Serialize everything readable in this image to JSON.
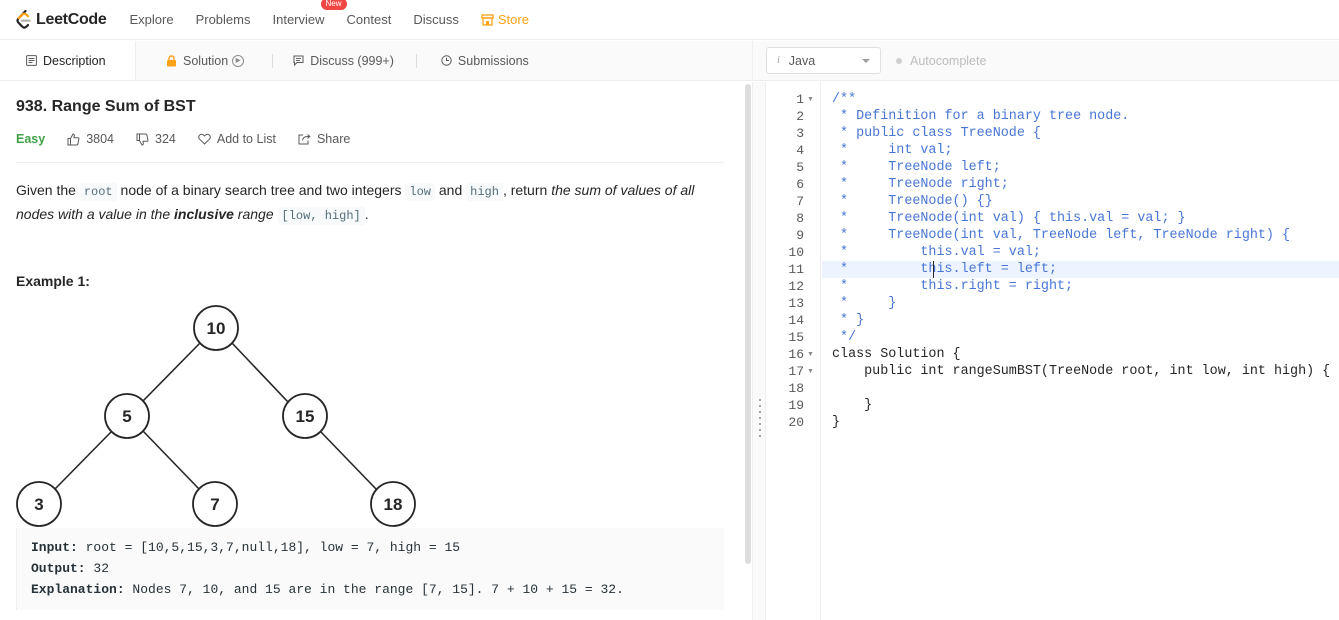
{
  "nav": {
    "logo_text": "LeetCode",
    "items": [
      {
        "label": "Explore"
      },
      {
        "label": "Problems"
      },
      {
        "label": "Interview",
        "badge": "New"
      },
      {
        "label": "Contest"
      },
      {
        "label": "Discuss"
      }
    ],
    "store_label": "Store",
    "store_color": "#ffa116",
    "badge_color": "#ef4743"
  },
  "tabs": {
    "description": "Description",
    "solution": "Solution",
    "discuss": "Discuss (999+)",
    "submissions": "Submissions"
  },
  "problem": {
    "title": "938. Range Sum of BST",
    "difficulty": "Easy",
    "difficulty_color": "#43a047",
    "likes": "3804",
    "dislikes": "324",
    "add_to_list": "Add to List",
    "share": "Share",
    "desc": {
      "p1": "Given the ",
      "c1": "root",
      "p2": " node of a binary search tree and two integers ",
      "c2": "low",
      "p3": " and ",
      "c3": "high",
      "p4": ", return ",
      "e1": "the sum of values of all nodes with a value in the ",
      "b1": "inclusive",
      "e2": " range ",
      "c4": "[low, high]",
      "p5": "."
    },
    "example_title": "Example 1:",
    "tree_nodes": [
      "10",
      "5",
      "15",
      "3",
      "7",
      "18"
    ],
    "example": {
      "input_label": "Input:",
      "input_value": " root = [10,5,15,3,7,null,18], low = 7, high = 15",
      "output_label": "Output:",
      "output_value": " 32",
      "explanation_label": "Explanation:",
      "explanation_value": " Nodes 7, 10, and 15 are in the range [7, 15]. 7 + 10 + 15 = 32."
    }
  },
  "editor": {
    "language": "Java",
    "language_icon": "i",
    "autocomplete": "Autocomplete",
    "line_numbers": [
      "1",
      "2",
      "3",
      "4",
      "5",
      "6",
      "7",
      "8",
      "9",
      "10",
      "11",
      "12",
      "13",
      "14",
      "15",
      "16",
      "17",
      "18",
      "19",
      "20"
    ],
    "lines": [
      "/**",
      " * Definition for a binary tree node.",
      " * public class TreeNode {",
      " *     int val;",
      " *     TreeNode left;",
      " *     TreeNode right;",
      " *     TreeNode() {}",
      " *     TreeNode(int val) { this.val = val; }",
      " *     TreeNode(int val, TreeNode left, TreeNode right) {",
      " *         this.val = val;",
      " *         this.left = left;",
      " *         this.right = right;",
      " *     }",
      " * }",
      " */",
      "class Solution {",
      "    public int rangeSumBST(TreeNode root, int low, int high) {",
      "        ",
      "    }",
      "}"
    ],
    "comment_color": "#4876d6"
  }
}
